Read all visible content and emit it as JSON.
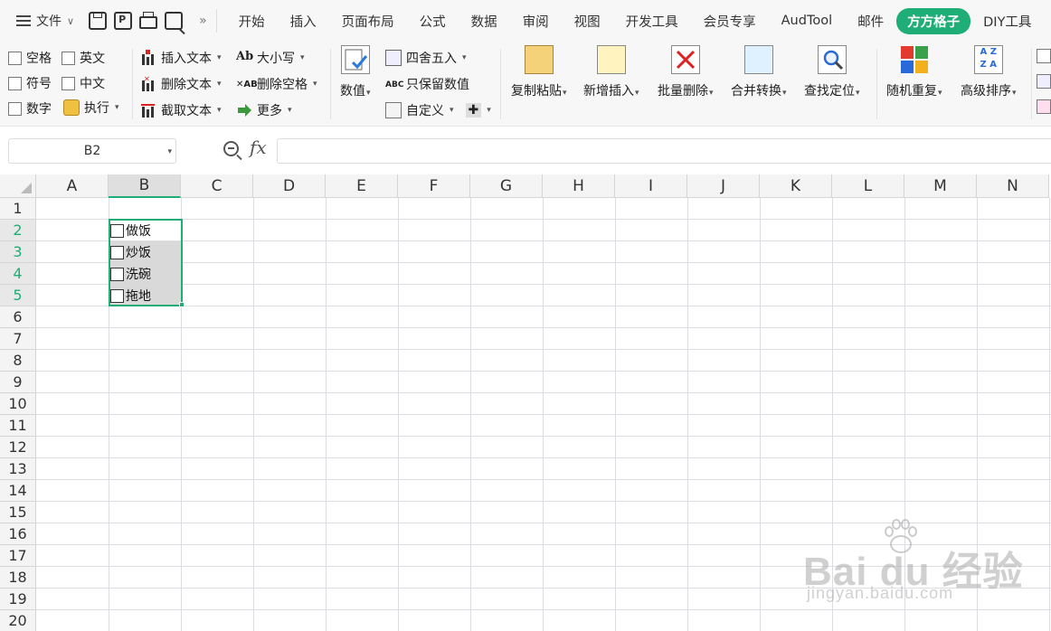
{
  "tabbar": {
    "file_menu": "文件",
    "tabs": [
      "开始",
      "插入",
      "页面布局",
      "公式",
      "数据",
      "审阅",
      "视图",
      "开发工具",
      "会员专享",
      "AudTool",
      "邮件",
      "方方格子",
      "DIY工具"
    ],
    "active_tab": "方方格子",
    "more_glyph": "»"
  },
  "ribbon": {
    "checks": [
      "空格",
      "英文",
      "符号",
      "中文",
      "数字"
    ],
    "execute": "执行",
    "text_ops": [
      "插入文本",
      "删除文本",
      "截取文本"
    ],
    "case_ops": [
      "大小写",
      "删除空格",
      "更多"
    ],
    "number": "数值",
    "round_ops": [
      "四舍五入",
      "只保留数值",
      "自定义"
    ],
    "big_buttons": [
      "复制粘贴",
      "新增插入",
      "批量删除",
      "合并转换",
      "查找定位",
      "随机重复",
      "高级排序"
    ],
    "accent": "#1fae76"
  },
  "formula_bar": {
    "name_box": "B2",
    "fx": "fx",
    "formula": ""
  },
  "grid": {
    "columns": [
      "A",
      "B",
      "C",
      "D",
      "E",
      "F",
      "G",
      "H",
      "I",
      "J",
      "K",
      "L",
      "M",
      "N"
    ],
    "rows": [
      "1",
      "2",
      "3",
      "4",
      "5",
      "6",
      "7",
      "8",
      "9",
      "10",
      "11",
      "12",
      "13",
      "14",
      "15",
      "16",
      "17",
      "18",
      "19",
      "20"
    ],
    "selected_column": "B",
    "selected_rows": [
      "2",
      "3",
      "4",
      "5"
    ],
    "cells": [
      {
        "ref": "B2",
        "checkbox": true,
        "text": "做饭"
      },
      {
        "ref": "B3",
        "checkbox": true,
        "text": "炒饭"
      },
      {
        "ref": "B4",
        "checkbox": true,
        "text": "洗碗"
      },
      {
        "ref": "B5",
        "checkbox": true,
        "text": "拖地"
      }
    ]
  },
  "watermark": {
    "line1": "Bai  du 经验",
    "line2": "jingyan.baidu.com"
  }
}
